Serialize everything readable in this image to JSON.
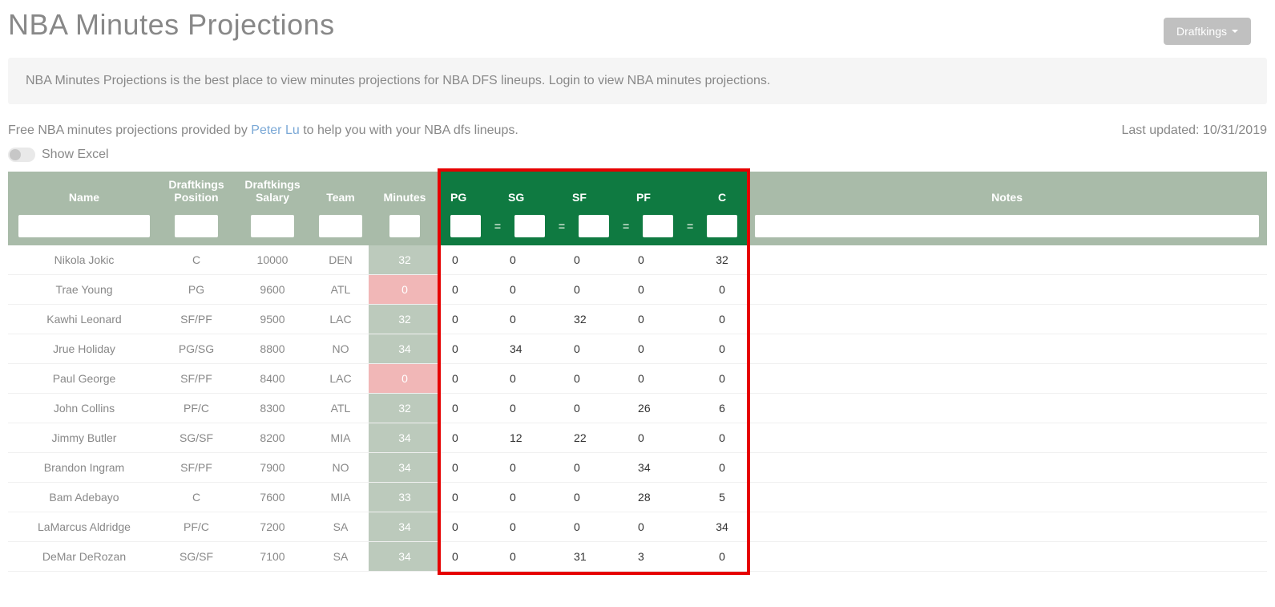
{
  "header": {
    "title": "NBA Minutes Projections",
    "site_label": "Draftkings"
  },
  "alert": {
    "text": "NBA Minutes Projections is the best place to view minutes projections for NBA DFS lineups. Login to view NBA minutes projections."
  },
  "info": {
    "pre": "Free NBA minutes projections provided by ",
    "author": "Peter Lu",
    "post": " to help you with your NBA dfs lineups.",
    "last_updated_label": "Last updated: ",
    "last_updated_value": "10/31/2019"
  },
  "toggle": {
    "label": "Show Excel"
  },
  "columns": {
    "name": "Name",
    "dk_pos": "Draftkings Position",
    "dk_sal": "Draftkings Salary",
    "team": "Team",
    "minutes": "Minutes",
    "pg": "PG",
    "sg": "SG",
    "sf": "SF",
    "pf": "PF",
    "c": "C",
    "notes": "Notes"
  },
  "rows": [
    {
      "name": "Nikola Jokic",
      "pos": "C",
      "salary": "10000",
      "team": "DEN",
      "minutes": "32",
      "min_class": "min-ok",
      "pg": "0",
      "sg": "0",
      "sf": "0",
      "pf": "0",
      "c": "32",
      "notes": ""
    },
    {
      "name": "Trae Young",
      "pos": "PG",
      "salary": "9600",
      "team": "ATL",
      "minutes": "0",
      "min_class": "min-zero",
      "pg": "0",
      "sg": "0",
      "sf": "0",
      "pf": "0",
      "c": "0",
      "notes": ""
    },
    {
      "name": "Kawhi Leonard",
      "pos": "SF/PF",
      "salary": "9500",
      "team": "LAC",
      "minutes": "32",
      "min_class": "min-ok",
      "pg": "0",
      "sg": "0",
      "sf": "32",
      "pf": "0",
      "c": "0",
      "notes": ""
    },
    {
      "name": "Jrue Holiday",
      "pos": "PG/SG",
      "salary": "8800",
      "team": "NO",
      "minutes": "34",
      "min_class": "min-ok",
      "pg": "0",
      "sg": "34",
      "sf": "0",
      "pf": "0",
      "c": "0",
      "notes": ""
    },
    {
      "name": "Paul George",
      "pos": "SF/PF",
      "salary": "8400",
      "team": "LAC",
      "minutes": "0",
      "min_class": "min-zero",
      "pg": "0",
      "sg": "0",
      "sf": "0",
      "pf": "0",
      "c": "0",
      "notes": ""
    },
    {
      "name": "John Collins",
      "pos": "PF/C",
      "salary": "8300",
      "team": "ATL",
      "minutes": "32",
      "min_class": "min-ok",
      "pg": "0",
      "sg": "0",
      "sf": "0",
      "pf": "26",
      "c": "6",
      "notes": ""
    },
    {
      "name": "Jimmy Butler",
      "pos": "SG/SF",
      "salary": "8200",
      "team": "MIA",
      "minutes": "34",
      "min_class": "min-ok",
      "pg": "0",
      "sg": "12",
      "sf": "22",
      "pf": "0",
      "c": "0",
      "notes": ""
    },
    {
      "name": "Brandon Ingram",
      "pos": "SF/PF",
      "salary": "7900",
      "team": "NO",
      "minutes": "34",
      "min_class": "min-ok",
      "pg": "0",
      "sg": "0",
      "sf": "0",
      "pf": "34",
      "c": "0",
      "notes": ""
    },
    {
      "name": "Bam Adebayo",
      "pos": "C",
      "salary": "7600",
      "team": "MIA",
      "minutes": "33",
      "min_class": "min-ok",
      "pg": "0",
      "sg": "0",
      "sf": "0",
      "pf": "28",
      "c": "5",
      "notes": ""
    },
    {
      "name": "LaMarcus Aldridge",
      "pos": "PF/C",
      "salary": "7200",
      "team": "SA",
      "minutes": "34",
      "min_class": "min-ok",
      "pg": "0",
      "sg": "0",
      "sf": "0",
      "pf": "0",
      "c": "34",
      "notes": ""
    },
    {
      "name": "DeMar DeRozan",
      "pos": "SG/SF",
      "salary": "7100",
      "team": "SA",
      "minutes": "34",
      "min_class": "min-ok",
      "pg": "0",
      "sg": "0",
      "sf": "31",
      "pf": "3",
      "c": "0",
      "notes": ""
    }
  ]
}
